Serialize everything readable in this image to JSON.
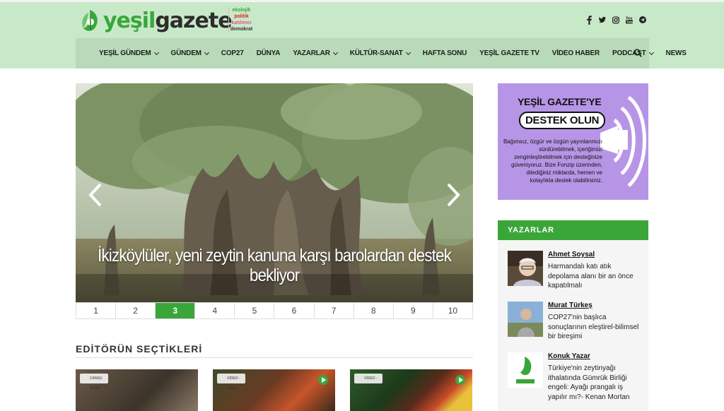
{
  "site": {
    "logo_text_green": "yeşil",
    "logo_text_dark": "gazete",
    "tagline": [
      "ekolojik",
      "politik",
      "katılımcı",
      "demokrat"
    ]
  },
  "social_icons": [
    "facebook-icon",
    "twitter-icon",
    "instagram-icon",
    "youtube-icon",
    "telegram-icon"
  ],
  "nav": {
    "items": [
      {
        "label": "YEŞİL GÜNDEM",
        "dropdown": true
      },
      {
        "label": "GÜNDEM",
        "dropdown": true
      },
      {
        "label": "COP27",
        "dropdown": false
      },
      {
        "label": "DÜNYA",
        "dropdown": false
      },
      {
        "label": "YAZARLAR",
        "dropdown": true
      },
      {
        "label": "KÜLTÜR-SANAT",
        "dropdown": true
      },
      {
        "label": "HAFTA SONU",
        "dropdown": false
      },
      {
        "label": "YEŞİL GAZETE TV",
        "dropdown": false
      },
      {
        "label": "VİDEO HABER",
        "dropdown": false
      },
      {
        "label": "PODCAST",
        "dropdown": true
      },
      {
        "label": "NEWS",
        "dropdown": false
      }
    ]
  },
  "slider": {
    "title": "İkizköylüler, yeni zeytin kanuna karşı barolardan destek bekliyor",
    "pages": [
      "1",
      "2",
      "3",
      "4",
      "5",
      "6",
      "7",
      "8",
      "9",
      "10"
    ],
    "active_page": "3"
  },
  "editor": {
    "title": "EDİTÖRÜN SEÇTİKLERİ",
    "thumbs": [
      {
        "badge": "CANSU ACAR",
        "play": false
      },
      {
        "badge": "VİDEO - ÖZEL",
        "play": true
      },
      {
        "badge": "VİDEO - ÖZEL",
        "play": true
      }
    ]
  },
  "support": {
    "heading": "YEŞİL GAZETE'YE",
    "button": "DESTEK OLUN",
    "body": "Bağımsız, özgür ve özgün yayınlarımızı sürdürebilmek, içeriğimizi zenginleştirebilmek için desteğinize güveniyoruz. Bize Fonzip üzerinden, dilediğiniz miktarda, hemen ve kolaylıkla destek olabilirsiniz."
  },
  "writers": {
    "title": "YAZARLAR",
    "items": [
      {
        "name": "Ahmet Soysal",
        "headline": "Harmandalı katı atık depolama alanı bir an önce kapatılmalı"
      },
      {
        "name": "Murat Türkeş",
        "headline": "COP27'nin başlıca sonuçlarının eleştirel-bilimsel bir bireşimi"
      },
      {
        "name": "Konuk Yazar",
        "headline": "Türkiye'nin zeytinyağı ithalatında Gümrük Birliği engeli: Ayağı prangalı iş yapılır mı?- Kenan Mortan"
      }
    ]
  },
  "colors": {
    "header_bg": "#c8e9c8",
    "nav_bg": "#b9dab9",
    "accent_green": "#3aa63a",
    "support_purple": "#b695e6"
  }
}
